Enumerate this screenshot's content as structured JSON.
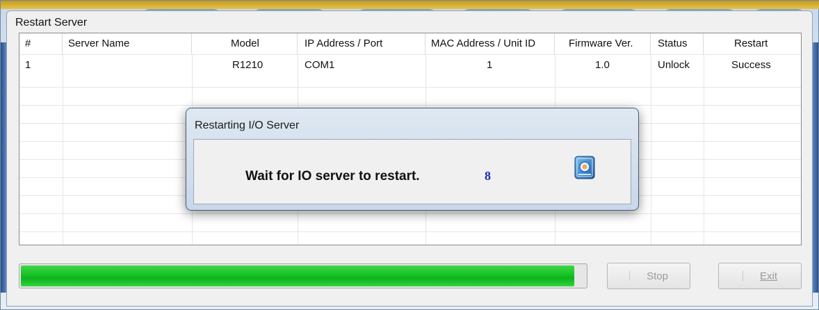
{
  "window": {
    "title": "Restart Server"
  },
  "table": {
    "columns": [
      "#",
      "Server Name",
      "Model",
      "IP Address / Port",
      "MAC Address / Unit ID",
      "Firmware Ver.",
      "Status",
      "Restart"
    ],
    "rows": [
      [
        "1",
        "",
        "R1210",
        "COM1",
        "1",
        "1.0",
        "Unlock",
        "Success"
      ]
    ]
  },
  "progress": {
    "value_percent": 98
  },
  "buttons": {
    "stop_label": "Stop",
    "exit_label": "Exit"
  },
  "dialog": {
    "title": "Restarting I/O Server",
    "message": "Wait for IO server to restart.",
    "countdown": "8",
    "icon": "io-server-icon"
  },
  "colors": {
    "progress": "#15c224",
    "countdown": "#1a2bb0"
  }
}
